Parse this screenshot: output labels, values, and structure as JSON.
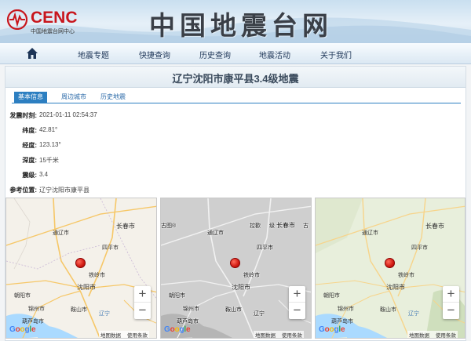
{
  "header": {
    "logo_brand": "CENC",
    "logo_sub": "中国地震台网中心",
    "site_title": "中国地震台网"
  },
  "nav": {
    "home_icon": "home-icon",
    "items": [
      "地震专题",
      "快捷查询",
      "历史查询",
      "地震活动",
      "关于我们"
    ]
  },
  "event": {
    "title": "辽宁沈阳市康平县3.4级地震",
    "tabs": [
      "基本信息",
      "周边城市",
      "历史地震"
    ],
    "active_tab": "基本信息",
    "fields": [
      {
        "key": "发震时刻:",
        "value": "2021-01-11 02:54:37"
      },
      {
        "key": "纬度:",
        "value": "42.81°"
      },
      {
        "key": "经度:",
        "value": "123.13°"
      },
      {
        "key": "深度:",
        "value": "15千米"
      },
      {
        "key": "震级:",
        "value": "3.4"
      },
      {
        "key": "参考位置:",
        "value": "辽宁沈阳市康平县"
      }
    ]
  },
  "maps": {
    "attribution_data": "地图数据",
    "attribution_terms": "使用条款",
    "google": [
      "G",
      "o",
      "o",
      "g",
      "l",
      "e"
    ],
    "zoom_in": "+",
    "zoom_out": "−",
    "colors": {
      "pin": "#d01a12",
      "accent": "#2d7fc1",
      "brand_red": "#c8161d"
    },
    "roadmap": {
      "labels": {
        "changchun": "长春市",
        "tongliao": "通辽市",
        "siping": "四平市",
        "tieling": "铁岭市",
        "shenyang": "沈阳市",
        "chaoyang": "朝阳市",
        "jinzhou": "锦州市",
        "anshan": "鞍山市",
        "huludao": "葫芦岛市",
        "liaoning": "辽宁"
      }
    },
    "gray": {
      "labels": {
        "changchun": "长春市",
        "tongliao": "通辽市",
        "siping": "四平市",
        "tieling": "铁岭市",
        "shenyang": "沈阳市",
        "chaoyang": "朝阳市",
        "jinzhou": "锦州市",
        "anshan": "鞍山市",
        "huludao": "葫芦岛市",
        "liaoning": "辽宁",
        "tai": "吉",
        "edge_left": "古图®",
        "edge_mid": "控歡",
        "edge_mid2": "级",
        "edge_right": "古"
      }
    },
    "terrain": {
      "labels": {
        "changchun": "长春市",
        "tongliao": "通辽市",
        "siping": "四平市",
        "tieling": "铁岭市",
        "shenyang": "沈阳市",
        "chaoyang": "朝阳市",
        "jinzhou": "锦州市",
        "anshan": "鞍山市",
        "huludao": "葫芦岛市",
        "liaoning": "辽宁"
      }
    }
  }
}
